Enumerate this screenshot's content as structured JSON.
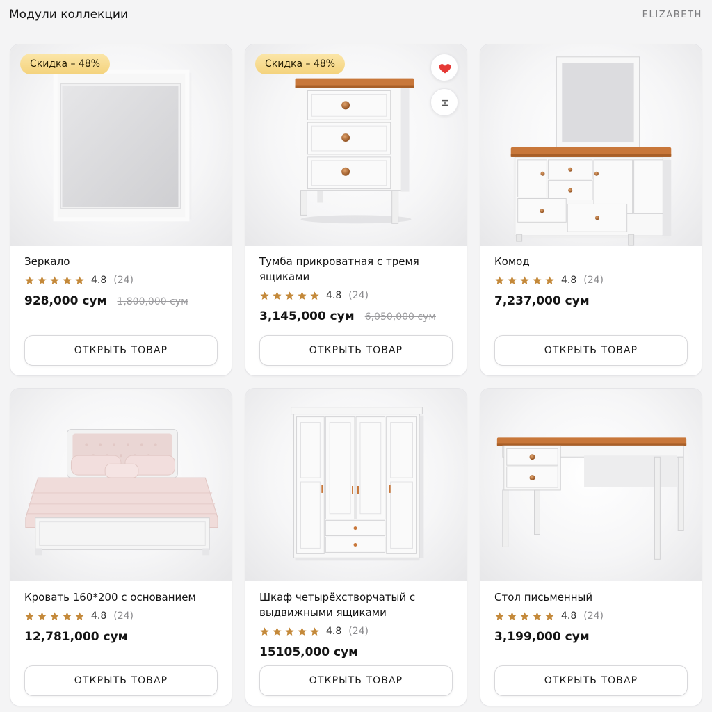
{
  "header": {
    "title": "Модули коллекции",
    "brand": "ELIZABETH"
  },
  "colors": {
    "badge": "#f4d27c",
    "heart": "#e53935",
    "star": "#c4893a",
    "wood": "#c8773a"
  },
  "products": [
    {
      "name": "Зеркало",
      "rating": "4.8",
      "reviews": "(24)",
      "price": "928,000 сум",
      "old_price": "1,800,000 сум",
      "badge": "Скидка – 48%",
      "button": "ОТКРЫТЬ ТОВАР",
      "image_icon": "mirror-icon"
    },
    {
      "name": "Тумба прикроватная с тремя ящиками",
      "rating": "4.8",
      "reviews": "(24)",
      "price": "3,145,000 сум",
      "old_price": "6,050,000 сум",
      "badge": "Скидка – 48%",
      "button": "ОТКРЫТЬ ТОВАР",
      "image_icon": "nightstand-icon",
      "favorite_icon": "heart-icon",
      "compare_icon": "compare-icon"
    },
    {
      "name": "Комод",
      "rating": "4.8",
      "reviews": "(24)",
      "price": "7,237,000 сум",
      "button": "ОТКРЫТЬ ТОВАР",
      "image_icon": "dresser-icon"
    },
    {
      "name": "Кровать 160*200 с основанием",
      "rating": "4.8",
      "reviews": "(24)",
      "price": "12,781,000 сум",
      "button": "ОТКРЫТЬ ТОВАР",
      "image_icon": "bed-icon"
    },
    {
      "name": "Шкаф четырёхстворчатый с выдвижными ящиками",
      "rating": "4.8",
      "reviews": "(24)",
      "price": "15105,000 сум",
      "button": "ОТКРЫТЬ ТОВАР",
      "image_icon": "wardrobe-icon"
    },
    {
      "name": "Стол письменный",
      "rating": "4.8",
      "reviews": "(24)",
      "price": "3,199,000 сум",
      "button": "ОТКРЫТЬ ТОВАР",
      "image_icon": "desk-icon"
    }
  ]
}
